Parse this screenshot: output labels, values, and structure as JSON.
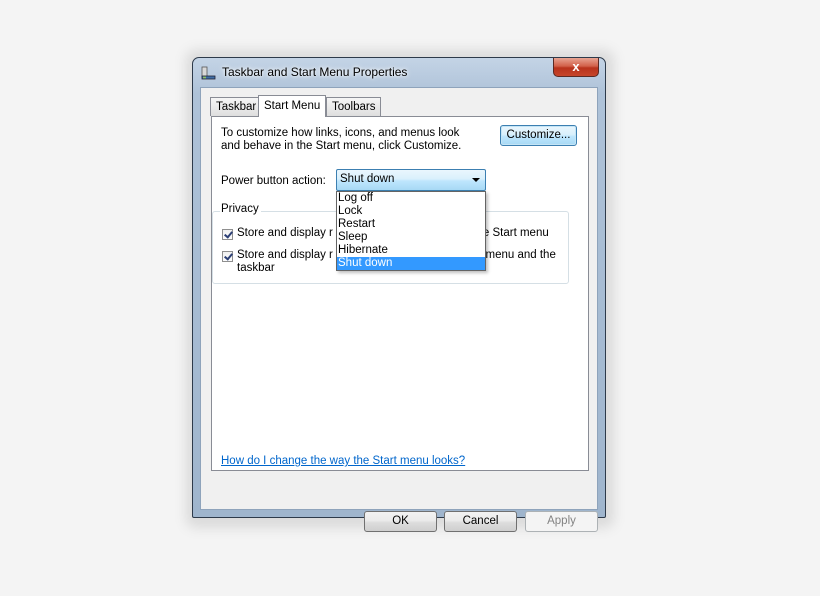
{
  "window": {
    "title": "Taskbar and Start Menu Properties",
    "close_glyph": "x"
  },
  "tabs": [
    {
      "label": "Taskbar",
      "active": false
    },
    {
      "label": "Start Menu",
      "active": true
    },
    {
      "label": "Toolbars",
      "active": false
    }
  ],
  "start_menu": {
    "description": "To customize how links, icons, and menus look and behave in the Start menu, click Customize.",
    "customize_label": "Customize...",
    "power_label": "Power button action:",
    "power_value": "Shut down",
    "power_options": [
      "Log off",
      "Lock",
      "Restart",
      "Sleep",
      "Hibernate",
      "Shut down"
    ],
    "privacy": {
      "legend": "Privacy",
      "checks": [
        {
          "left": "Store and display r",
          "right": "e Start menu",
          "checked": true
        },
        {
          "left": "Store and display r",
          "right": "art menu and the",
          "line2": "taskbar",
          "checked": true
        }
      ]
    },
    "help_link": "How do I change the way the Start menu looks?"
  },
  "buttons": {
    "ok": "OK",
    "cancel": "Cancel",
    "apply": "Apply"
  },
  "colors": {
    "selection": "#3399ff",
    "link": "#0066cc",
    "close": "#c6452b"
  }
}
